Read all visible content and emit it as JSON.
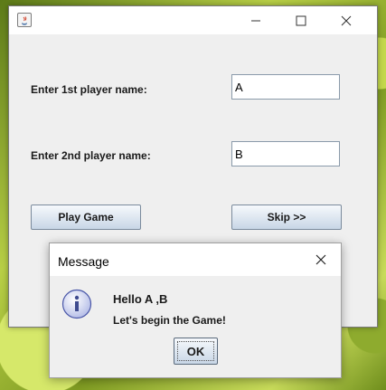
{
  "main_window": {
    "form": {
      "player1_label": "Enter 1st player name:",
      "player1_value": "A",
      "player2_label": "Enter 2nd player name:",
      "player2_value": "B"
    },
    "buttons": {
      "play_label": "Play Game",
      "skip_label": "Skip >>"
    }
  },
  "dialog": {
    "title": "Message",
    "icon": "info-icon",
    "line1": "Hello A ,B",
    "line2": "Let's begin the Game!",
    "ok_label": "OK"
  }
}
